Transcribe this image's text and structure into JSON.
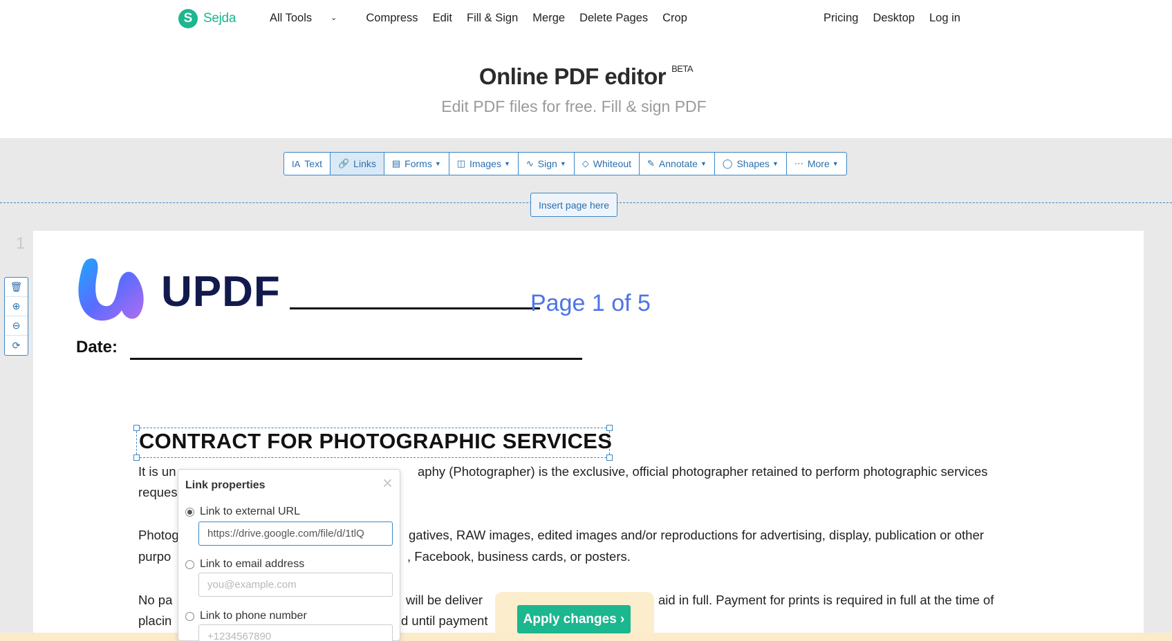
{
  "brand": {
    "name": "Sejda",
    "mark": "S",
    "color": "#1cb68f"
  },
  "nav": {
    "left": [
      "All Tools",
      "Compress",
      "Edit",
      "Fill & Sign",
      "Merge",
      "Delete Pages",
      "Crop"
    ],
    "right": [
      "Pricing",
      "Desktop",
      "Log in"
    ]
  },
  "hero": {
    "title": "Online PDF editor",
    "badge": "BETA",
    "subtitle": "Edit PDF files for free. Fill & sign PDF"
  },
  "toolbar": {
    "tools": [
      {
        "label": "Text",
        "icon": "text-icon"
      },
      {
        "label": "Links",
        "icon": "link-icon",
        "active": true
      },
      {
        "label": "Forms",
        "icon": "forms-icon",
        "dropdown": true
      },
      {
        "label": "Images",
        "icon": "image-icon",
        "dropdown": true
      },
      {
        "label": "Sign",
        "icon": "signature-icon",
        "dropdown": true
      },
      {
        "label": "Whiteout",
        "icon": "eraser-icon"
      },
      {
        "label": "Annotate",
        "icon": "pen-icon",
        "dropdown": true
      },
      {
        "label": "Shapes",
        "icon": "shapes-icon",
        "dropdown": true
      },
      {
        "label": "More",
        "icon": "more-icon",
        "dropdown": true
      }
    ]
  },
  "insert_page_label": "Insert page here",
  "page_number": "1",
  "document": {
    "logo_text": "UPDF",
    "page_of": "Page 1 of 5",
    "date_label": "Date:",
    "contract_title": "CONTRACT FOR PHOTOGRAPHIC SERVICES",
    "para1_line1_a": "It is un",
    "para1_line1_b": "aphy (Photographer) is the exclusive, official photographer retained to perform photographic services",
    "para1_line2": "reques",
    "para2_line1_a": "Photog",
    "para2_line1_b": "gatives, RAW images, edited images and/or reproductions for advertising, display, publication or other",
    "para2_line2_a": "purpo",
    "para2_line2_b": ", Facebook, business cards, or posters.",
    "para3_line1_a": "No pa",
    "para3_line1_b": "will be deliver",
    "para3_line1_c": "aid in full. Payment for prints is required in full at the time of",
    "para3_line2_a": "placin",
    "para3_line2_b": "d until payment"
  },
  "link_popup": {
    "title": "Link properties",
    "close": "×",
    "options": [
      {
        "label": "Link to external URL",
        "selected": true,
        "value": "https://drive.google.com/file/d/1tlQ",
        "placeholder": ""
      },
      {
        "label": "Link to email address",
        "selected": false,
        "value": "",
        "placeholder": "you@example.com"
      },
      {
        "label": "Link to phone number",
        "selected": false,
        "value": "",
        "placeholder": "+1234567890"
      }
    ]
  },
  "apply_button": "Apply changes ›",
  "colors": {
    "accent": "#3b87c6",
    "brand": "#1cb68f",
    "page_of_color": "#4c74e6",
    "updf_text": "#121a4d"
  }
}
